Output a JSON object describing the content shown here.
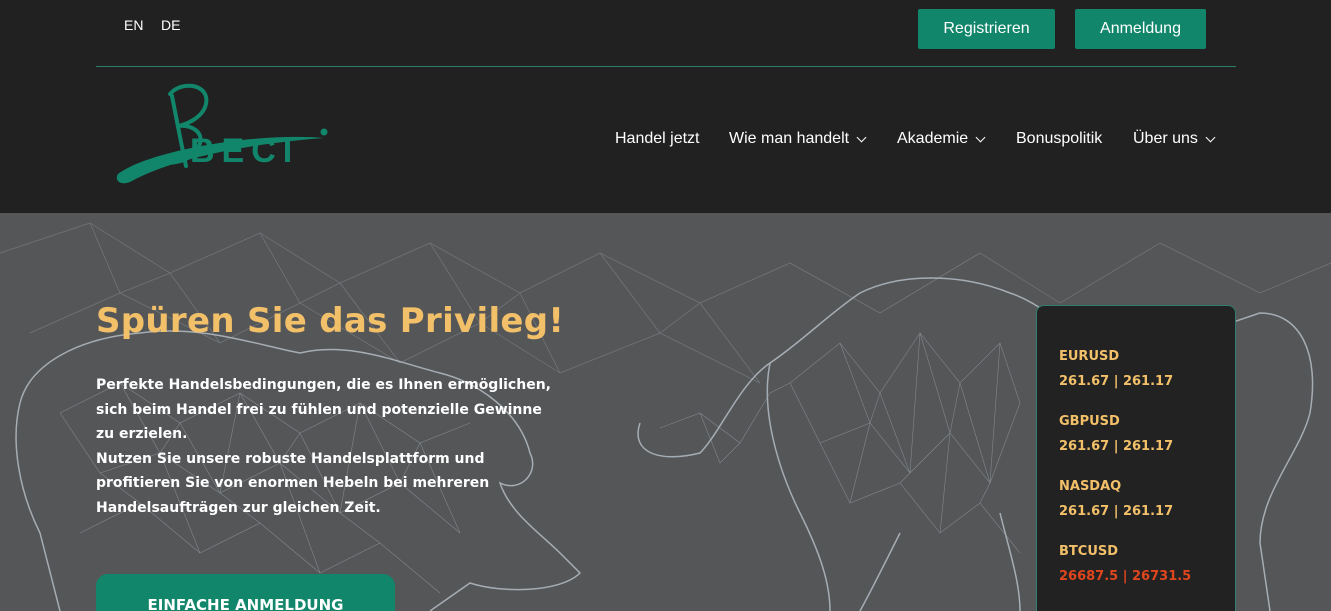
{
  "languages": [
    "EN",
    "DE"
  ],
  "top_buttons": {
    "register": "Registrieren",
    "login": "Anmeldung"
  },
  "logo": {
    "text": "BECI"
  },
  "nav": {
    "items": [
      {
        "label": "Handel jetzt",
        "dropdown": false
      },
      {
        "label": "Wie man handelt",
        "dropdown": true
      },
      {
        "label": "Akademie",
        "dropdown": true
      },
      {
        "label": "Bonuspolitik",
        "dropdown": false
      },
      {
        "label": "Über uns",
        "dropdown": true
      }
    ]
  },
  "hero": {
    "title": "Spüren Sie das Privileg!",
    "paragraph1": "Perfekte Handelsbedingungen, die es Ihnen ermöglichen, sich beim Handel frei zu fühlen und potenzielle Gewinne zu erzielen.",
    "paragraph2": "Nutzen Sie unsere robuste Handelsplattform und profitieren Sie von enormen Hebeln bei mehreren Handelsaufträgen zur gleichen Zeit.",
    "cta": "EINFACHE ANMELDUNG"
  },
  "ticker": [
    {
      "symbol": "EURUSD",
      "price": "261.67 | 261.17",
      "trend": "neutral"
    },
    {
      "symbol": "GBPUSD",
      "price": "261.67 | 261.17",
      "trend": "neutral"
    },
    {
      "symbol": "NASDAQ",
      "price": "261.67 | 261.17",
      "trend": "neutral"
    },
    {
      "symbol": "BTCUSD",
      "price": "26687.5 | 26731.5",
      "trend": "down"
    }
  ],
  "colors": {
    "accent": "#12866b",
    "gold": "#f3c06a",
    "down": "#e0461e",
    "header_bg": "#212121",
    "hero_bg": "#555658"
  }
}
